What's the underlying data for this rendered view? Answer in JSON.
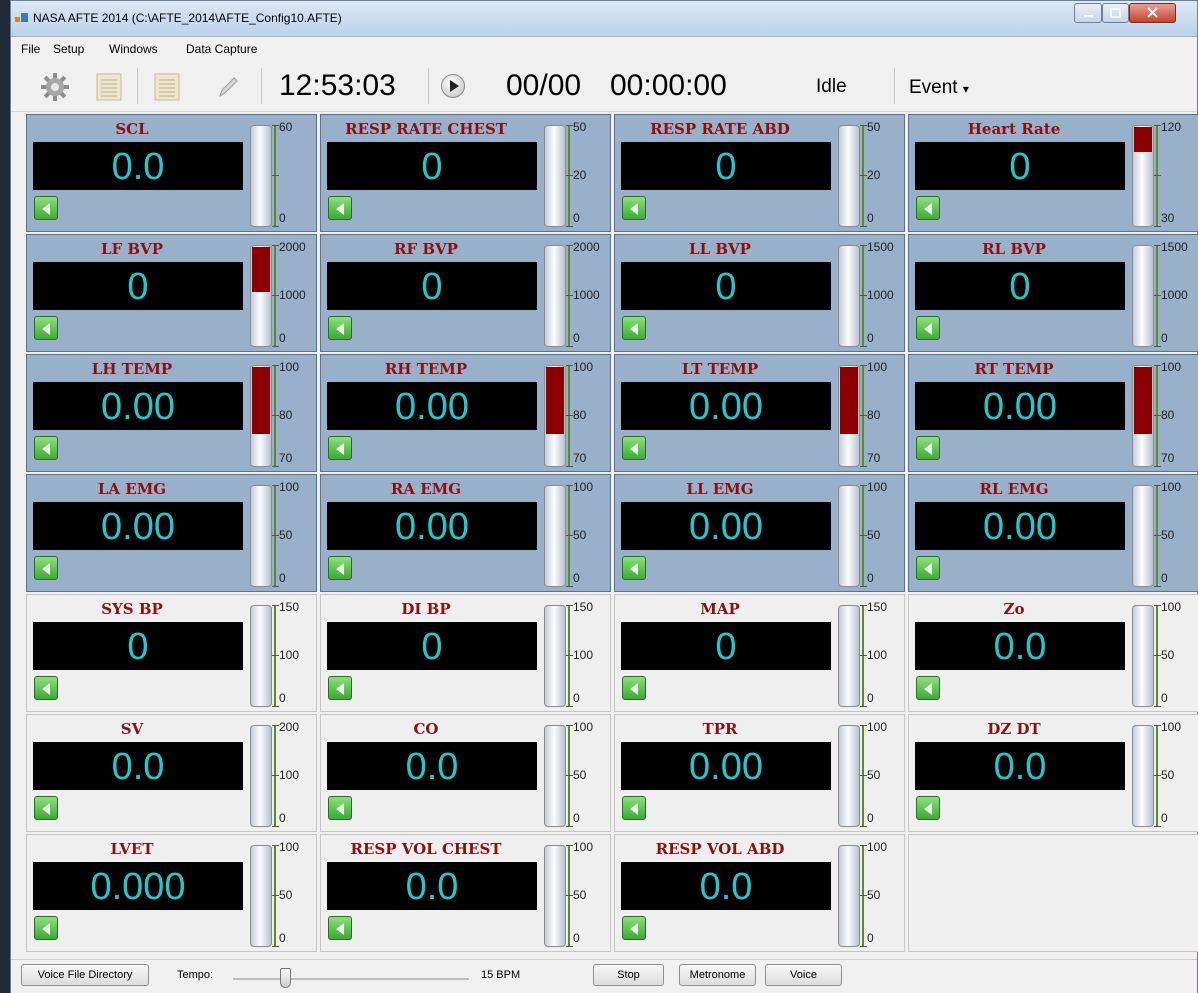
{
  "window": {
    "title": "NASA AFTE 2014 (C:\\AFTE_2014\\AFTE_Config10.AFTE)"
  },
  "menu": {
    "items": [
      "File",
      "Setup",
      "Windows",
      "Data Capture"
    ]
  },
  "toolbar": {
    "icons": [
      "gear-icon",
      "log-icon",
      "log-icon",
      "pencil-icon"
    ],
    "clock": "12:53:03",
    "counter": "00/00",
    "elapsed": "00:00:00",
    "status": "Idle",
    "event_label": "Event",
    "event_arrow": "▾"
  },
  "panels": [
    {
      "title": "SCL",
      "value": "0.0",
      "ticks": [
        "60",
        "",
        "0"
      ],
      "fill_color": "",
      "fill_frac": 0
    },
    {
      "title": "RESP RATE CHEST",
      "value": "0",
      "ticks": [
        "50",
        "20",
        "0"
      ],
      "fill_color": "",
      "fill_frac": 0
    },
    {
      "title": "RESP RATE ABD",
      "value": "0",
      "ticks": [
        "50",
        "20",
        "0"
      ],
      "fill_color": "",
      "fill_frac": 0
    },
    {
      "title": "Heart Rate",
      "value": "0",
      "ticks": [
        "120",
        "",
        "30"
      ],
      "fill_color": "#8b0000",
      "fill_frac": 0.25
    },
    {
      "title": "LF BVP",
      "value": "0",
      "ticks": [
        "2000",
        "1000",
        "0"
      ],
      "fill_color": "#8b0000",
      "fill_frac": 0.45
    },
    {
      "title": "RF BVP",
      "value": "0",
      "ticks": [
        "2000",
        "1000",
        "0"
      ],
      "fill_color": "",
      "fill_frac": 0
    },
    {
      "title": "LL BVP",
      "value": "0",
      "ticks": [
        "1500",
        "1000",
        "0"
      ],
      "fill_color": "",
      "fill_frac": 0
    },
    {
      "title": "RL BVP",
      "value": "0",
      "ticks": [
        "1500",
        "1000",
        "0"
      ],
      "fill_color": "",
      "fill_frac": 0
    },
    {
      "title": "LH TEMP",
      "value": "0.00",
      "ticks": [
        "100",
        "80",
        "70"
      ],
      "fill_color": "#8b0000",
      "fill_frac": 0.67
    },
    {
      "title": "RH TEMP",
      "value": "0.00",
      "ticks": [
        "100",
        "80",
        "70"
      ],
      "fill_color": "#8b0000",
      "fill_frac": 0.67
    },
    {
      "title": "LT TEMP",
      "value": "0.00",
      "ticks": [
        "100",
        "80",
        "70"
      ],
      "fill_color": "#8b0000",
      "fill_frac": 0.67
    },
    {
      "title": "RT TEMP",
      "value": "0.00",
      "ticks": [
        "100",
        "80",
        "70"
      ],
      "fill_color": "#8b0000",
      "fill_frac": 0.67
    },
    {
      "title": "LA EMG",
      "value": "0.00",
      "ticks": [
        "100",
        "50",
        "0"
      ],
      "fill_color": "",
      "fill_frac": 0
    },
    {
      "title": "RA EMG",
      "value": "0.00",
      "ticks": [
        "100",
        "50",
        "0"
      ],
      "fill_color": "",
      "fill_frac": 0
    },
    {
      "title": "LL EMG",
      "value": "0.00",
      "ticks": [
        "100",
        "50",
        "0"
      ],
      "fill_color": "",
      "fill_frac": 0
    },
    {
      "title": "RL EMG",
      "value": "0.00",
      "ticks": [
        "100",
        "50",
        "0"
      ],
      "fill_color": "",
      "fill_frac": 0
    },
    {
      "title": "SYS BP",
      "value": "0",
      "ticks": [
        "150",
        "100",
        "0"
      ],
      "fill_color": "",
      "fill_frac": 0
    },
    {
      "title": "DI BP",
      "value": "0",
      "ticks": [
        "150",
        "100",
        "0"
      ],
      "fill_color": "",
      "fill_frac": 0
    },
    {
      "title": "MAP",
      "value": "0",
      "ticks": [
        "150",
        "100",
        "0"
      ],
      "fill_color": "",
      "fill_frac": 0
    },
    {
      "title": "Zo",
      "value": "0.0",
      "ticks": [
        "100",
        "50",
        "0"
      ],
      "fill_color": "",
      "fill_frac": 0
    },
    {
      "title": "SV",
      "value": "0.0",
      "ticks": [
        "200",
        "100",
        "0"
      ],
      "fill_color": "",
      "fill_frac": 0
    },
    {
      "title": "CO",
      "value": "0.0",
      "ticks": [
        "100",
        "50",
        "0"
      ],
      "fill_color": "",
      "fill_frac": 0
    },
    {
      "title": "TPR",
      "value": "0.00",
      "ticks": [
        "100",
        "50",
        "0"
      ],
      "fill_color": "",
      "fill_frac": 0
    },
    {
      "title": "DZ DT",
      "value": "0.0",
      "ticks": [
        "100",
        "50",
        "0"
      ],
      "fill_color": "",
      "fill_frac": 0
    },
    {
      "title": "LVET",
      "value": "0.000",
      "ticks": [
        "100",
        "50",
        "0"
      ],
      "fill_color": "",
      "fill_frac": 0
    },
    {
      "title": "RESP VOL CHEST",
      "value": "0.0",
      "ticks": [
        "100",
        "50",
        "0"
      ],
      "fill_color": "",
      "fill_frac": 0
    },
    {
      "title": "RESP VOL ABD",
      "value": "0.0",
      "ticks": [
        "100",
        "50",
        "0"
      ],
      "fill_color": "",
      "fill_frac": 0
    }
  ],
  "statusbar": {
    "voice_dir_button": "Voice File Directory",
    "tempo_label": "Tempo:",
    "tempo_value": "15 BPM",
    "tempo_position": 0.22,
    "stop_button": "Stop",
    "metronome_button": "Metronome",
    "voice_button": "Voice"
  },
  "colors": {
    "panel_blue": "#98b0ca",
    "panel_gray": "#efefef",
    "title_red": "#8b1010",
    "display_cyan": "#27c6cc",
    "speaker_green": "#3caa33"
  }
}
